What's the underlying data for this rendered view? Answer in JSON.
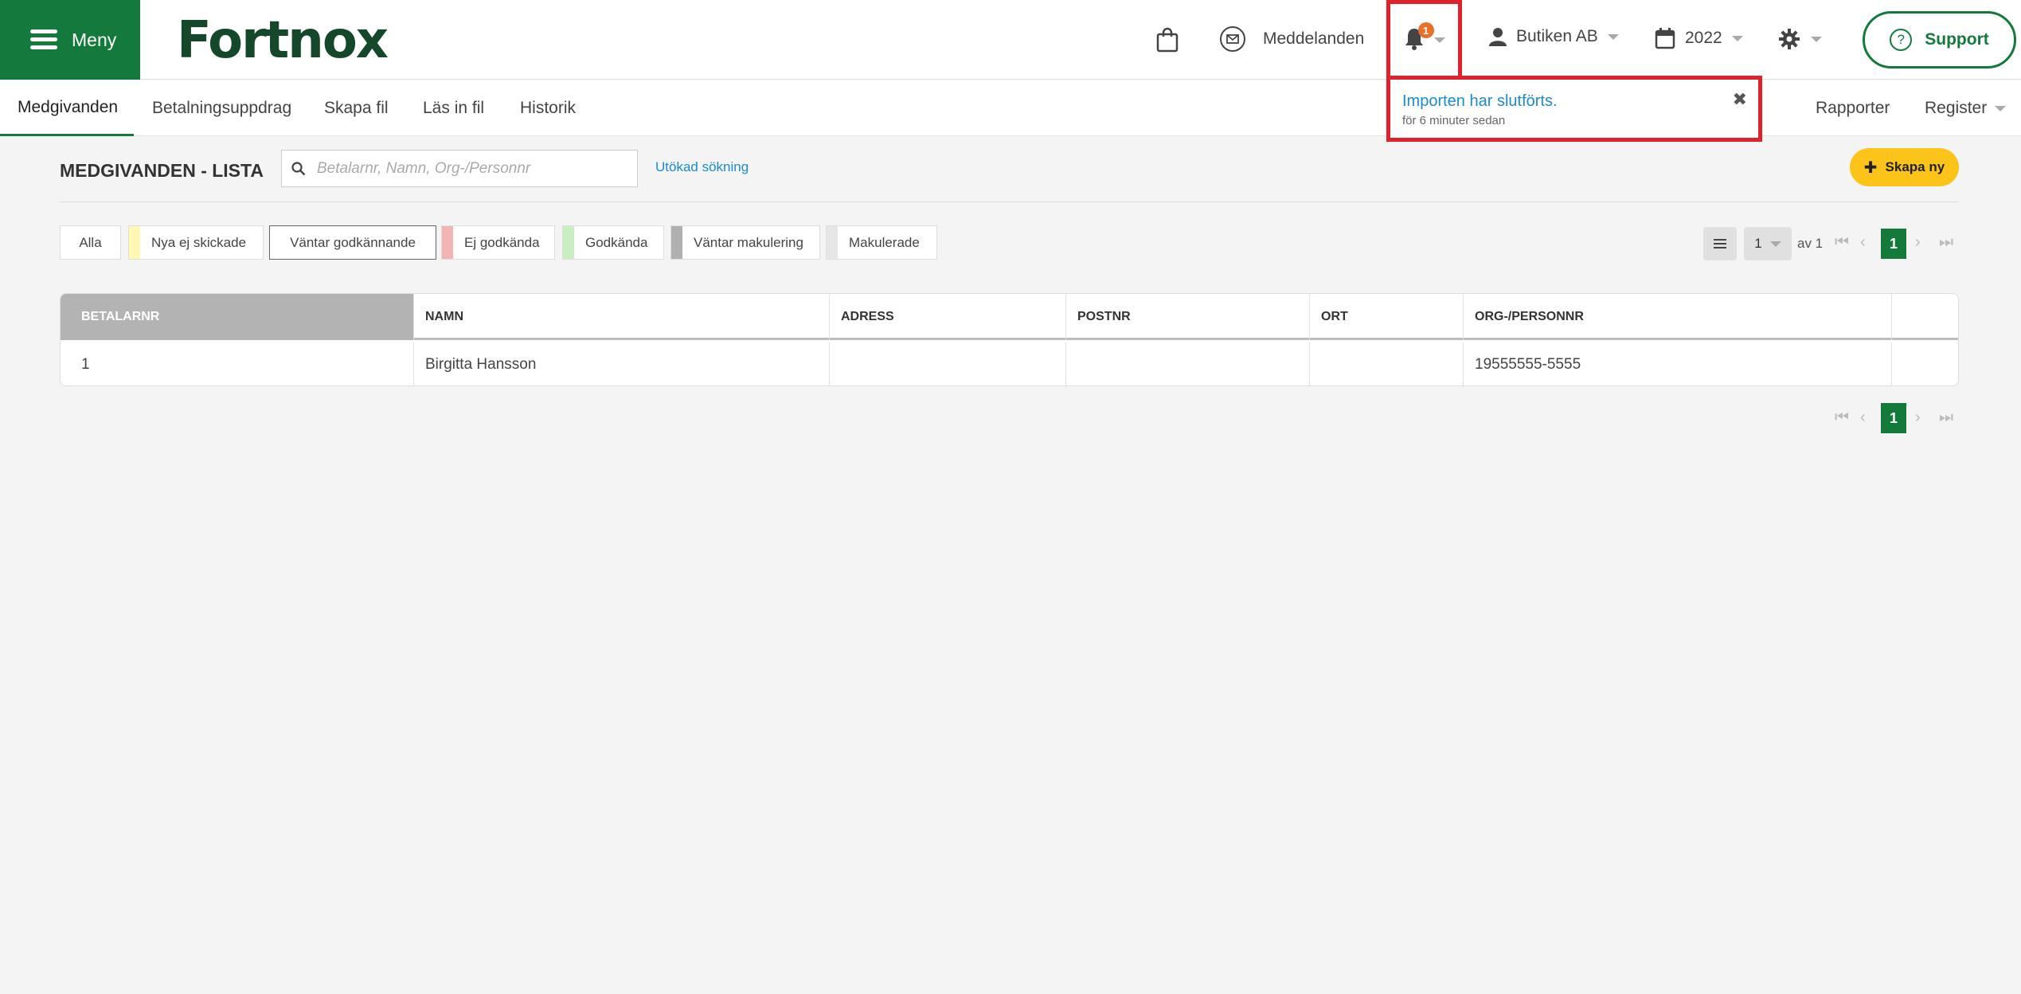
{
  "topbar": {
    "menu_label": "Meny",
    "logo": "Fortnox",
    "messages_label": "Meddelanden",
    "notification_count": "1",
    "company": "Butiken AB",
    "year": "2022",
    "support_label": "Support"
  },
  "subnav": {
    "tabs": [
      "Medgivanden",
      "Betalningsuppdrag",
      "Skapa fil",
      "Läs in fil",
      "Historik"
    ],
    "right": [
      "Rapporter",
      "Register"
    ]
  },
  "notification": {
    "title": "Importen har slutförts.",
    "time": "för 6 minuter sedan"
  },
  "list": {
    "title": "MEDGIVANDEN - LISTA",
    "search_placeholder": "Betalarnr, Namn, Org-/Personnr",
    "advanced_search": "Utökad sökning",
    "create_label": "Skapa ny"
  },
  "filters": [
    {
      "label": "Alla",
      "color": ""
    },
    {
      "label": "Nya ej skickade",
      "color": "#fff7b3"
    },
    {
      "label": "Väntar godkännande",
      "color": ""
    },
    {
      "label": "Ej godkända",
      "color": "#f4b4b4"
    },
    {
      "label": "Godkända",
      "color": "#c9efc0"
    },
    {
      "label": "Väntar makulering",
      "color": "#b0b0b0"
    },
    {
      "label": "Makulerade",
      "color": "#e6e6e6"
    }
  ],
  "pagination": {
    "per_page": "1",
    "of_label": "av 1",
    "current": "1"
  },
  "table": {
    "columns": [
      "BETALARNR",
      "NAMN",
      "ADRESS",
      "POSTNR",
      "ORT",
      "ORG-/PERSONNR",
      ""
    ],
    "rows": [
      [
        "1",
        "Birgitta Hansson",
        "",
        "",
        "",
        "19555555-5555",
        ""
      ]
    ]
  },
  "colors": {
    "brand_green": "#137a3c",
    "alert_red": "#e0202a",
    "accent_yellow": "#fcc419",
    "link_blue": "#1a8bd0"
  }
}
